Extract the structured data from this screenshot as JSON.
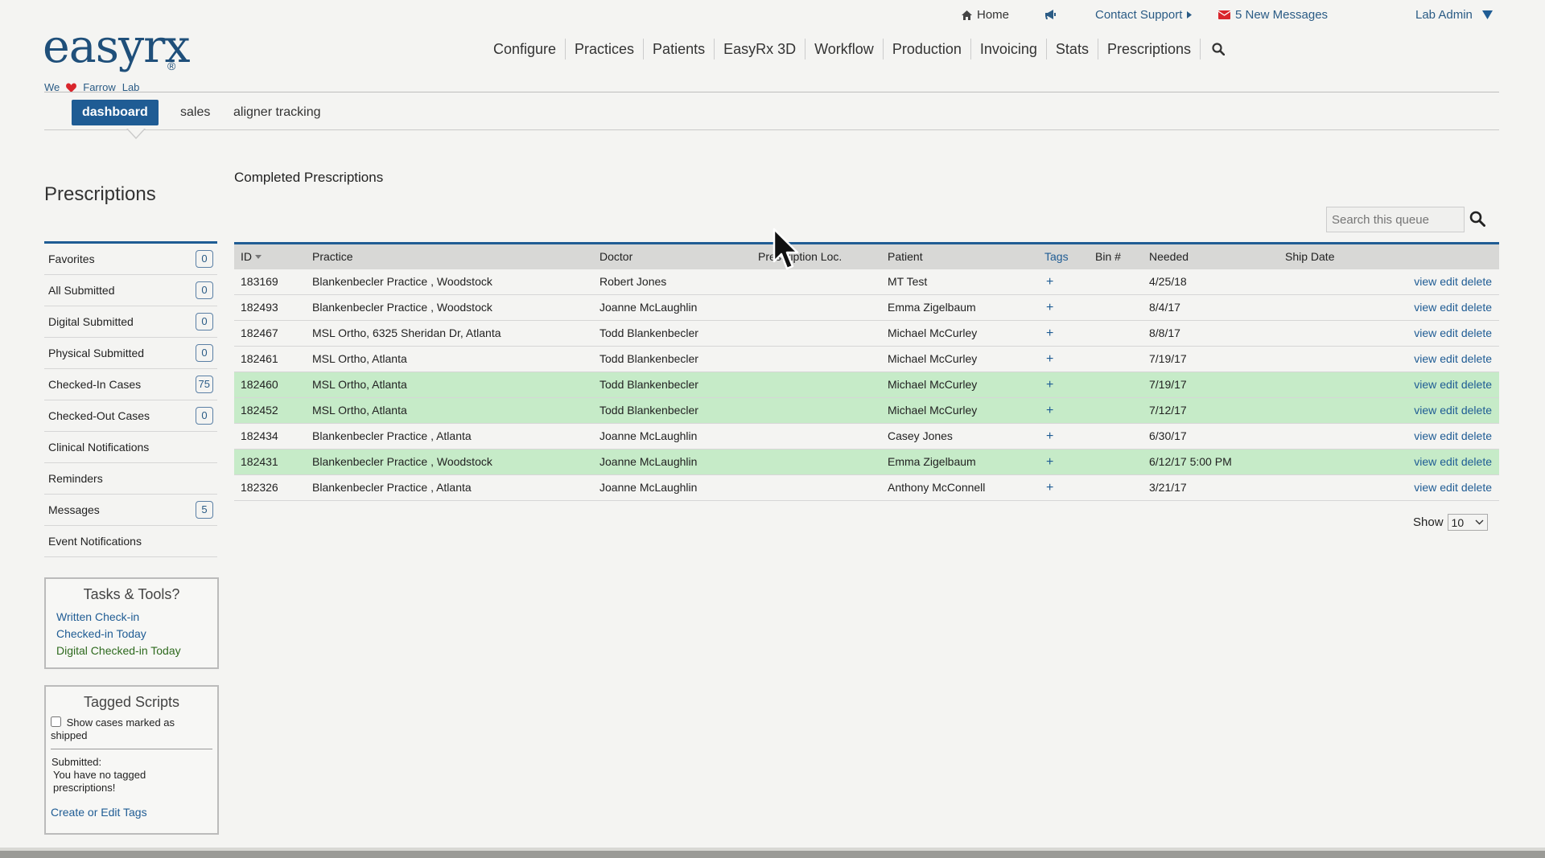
{
  "top_links": {
    "home": "Home",
    "contact_support": "Contact Support",
    "messages": "5 New Messages",
    "user": "Lab Admin"
  },
  "brand": {
    "logo_text": "easyrx",
    "registered": "®",
    "tagline_we": "We",
    "tagline_farrow": "Farrow",
    "tagline_lab": "Lab"
  },
  "nav": [
    "Configure",
    "Practices",
    "Patients",
    "EasyRx 3D",
    "Workflow",
    "Production",
    "Invoicing",
    "Stats",
    "Prescriptions"
  ],
  "subtabs": [
    "dashboard",
    "sales",
    "aligner tracking"
  ],
  "sidebar": {
    "title": "Prescriptions",
    "items": [
      {
        "label": "Favorites",
        "count": "0"
      },
      {
        "label": "All Submitted",
        "count": "0"
      },
      {
        "label": "Digital Submitted",
        "count": "0"
      },
      {
        "label": "Physical Submitted",
        "count": "0"
      },
      {
        "label": "Checked-In Cases",
        "count": "75"
      },
      {
        "label": "Checked-Out Cases",
        "count": "0"
      },
      {
        "label": "Clinical Notifications",
        "count": ""
      },
      {
        "label": "Reminders",
        "count": ""
      },
      {
        "label": "Messages",
        "count": "5"
      },
      {
        "label": "Event Notifications",
        "count": ""
      }
    ],
    "tasks": {
      "title": "Tasks & Tools?",
      "links": [
        "Written Check-in",
        "Checked-in Today",
        "Digital Checked-in Today"
      ]
    },
    "tagged": {
      "title": "Tagged Scripts",
      "checkbox_label": "Show cases marked as shipped",
      "submitted_label": "Submitted:",
      "empty_message": "You have no tagged prescriptions!",
      "link": "Create or Edit Tags"
    }
  },
  "main": {
    "title": "Completed Prescriptions",
    "search_placeholder": "Search this queue",
    "columns": [
      "ID",
      "Practice",
      "Doctor",
      "Prescription Loc.",
      "Patient",
      "Tags",
      "Bin #",
      "Needed",
      "Ship Date"
    ],
    "rows": [
      {
        "id": "183169",
        "practice": "Blankenbecler Practice , Woodstock",
        "doctor": "Robert Jones",
        "patient": "MT Test",
        "tags": "+",
        "needed": "4/25/18",
        "highlight": false
      },
      {
        "id": "182493",
        "practice": "Blankenbecler Practice , Woodstock",
        "doctor": "Joanne McLaughlin",
        "patient": "Emma Zigelbaum",
        "tags": "+",
        "needed": "8/4/17",
        "highlight": false
      },
      {
        "id": "182467",
        "practice": "MSL Ortho, 6325 Sheridan Dr, Atlanta",
        "doctor": "Todd Blankenbecler",
        "patient": "Michael McCurley",
        "tags": "+",
        "needed": "8/8/17",
        "highlight": false
      },
      {
        "id": "182461",
        "practice": "MSL Ortho, Atlanta",
        "doctor": "Todd Blankenbecler",
        "patient": "Michael McCurley",
        "tags": "+",
        "needed": "7/19/17",
        "highlight": false
      },
      {
        "id": "182460",
        "practice": "MSL Ortho, Atlanta",
        "doctor": "Todd Blankenbecler",
        "patient": "Michael McCurley",
        "tags": "+",
        "needed": "7/19/17",
        "highlight": true
      },
      {
        "id": "182452",
        "practice": "MSL Ortho, Atlanta",
        "doctor": "Todd Blankenbecler",
        "patient": "Michael McCurley",
        "tags": "+",
        "needed": "7/12/17",
        "highlight": true
      },
      {
        "id": "182434",
        "practice": "Blankenbecler Practice , Atlanta",
        "doctor": "Joanne McLaughlin",
        "patient": "Casey Jones",
        "tags": "+",
        "needed": "6/30/17",
        "highlight": false
      },
      {
        "id": "182431",
        "practice": "Blankenbecler Practice , Woodstock",
        "doctor": "Joanne McLaughlin",
        "patient": "Emma Zigelbaum",
        "tags": "+",
        "needed": "6/12/17 5:00 PM",
        "highlight": true
      },
      {
        "id": "182326",
        "practice": "Blankenbecler Practice , Atlanta",
        "doctor": "Joanne McLaughlin",
        "patient": "Anthony McConnell",
        "tags": "+",
        "needed": "3/21/17",
        "highlight": false
      }
    ],
    "actions": [
      "view",
      "edit",
      "delete"
    ],
    "show_label": "Show",
    "show_value": "10"
  },
  "colors": {
    "brand_blue": "#1f5c94",
    "row_highlight": "#c6ebc8",
    "alert_red": "#d9262c"
  }
}
